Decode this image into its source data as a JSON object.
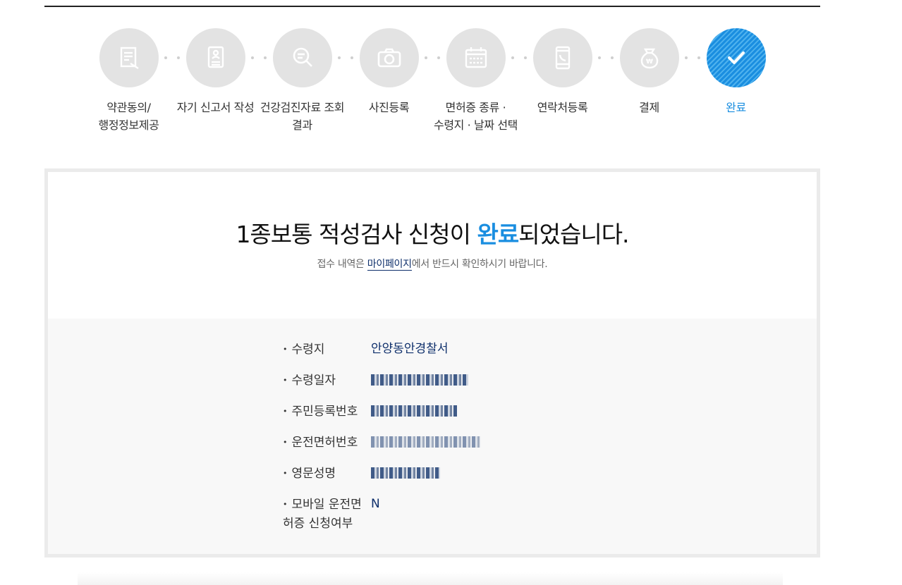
{
  "steps": [
    {
      "label": "약관동의/\n행정정보제공",
      "icon": "document-edit-icon",
      "active": false
    },
    {
      "label": "자기 신고서 작성",
      "icon": "person-document-icon",
      "active": false
    },
    {
      "label": "건강검진자료 조회\n결과",
      "icon": "search-icon",
      "active": false
    },
    {
      "label": "사진등록",
      "icon": "camera-icon",
      "active": false
    },
    {
      "label": "면허증 종류 ·\n수령지 · 날짜 선택",
      "icon": "calendar-icon",
      "active": false
    },
    {
      "label": "연락처등록",
      "icon": "phone-icon",
      "active": false
    },
    {
      "label": "결제",
      "icon": "money-bag-icon",
      "active": false
    },
    {
      "label": "완료",
      "icon": "check-icon",
      "active": true
    }
  ],
  "result": {
    "title_prefix": "1종보통 적성검사 신청이 ",
    "title_highlight": "완료",
    "title_suffix": "되었습니다.",
    "sub_prefix": "접수 내역은 ",
    "sub_link": "마이페이지",
    "sub_suffix": "에서 반드시 확인하시기 바랍니다."
  },
  "info": {
    "pickup_place_label": "수령지",
    "pickup_place_value": "안양동안경찰서",
    "pickup_date_label": "수령일자",
    "resident_no_label": "주민등록번호",
    "license_no_label": "운전면허번호",
    "english_name_label": "영문성명",
    "mobile_label": "모바일 운전면허증 신청여부",
    "mobile_value": "N"
  },
  "colors": {
    "accent": "#1a8ee0",
    "navy": "#0e2f6b",
    "step_bg": "#e3e3e3"
  }
}
